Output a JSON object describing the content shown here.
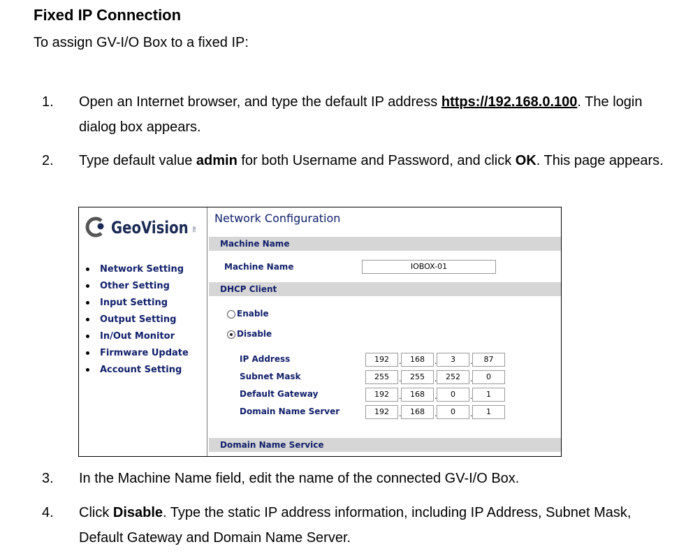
{
  "heading": "Fixed IP Connection",
  "intro": "To assign GV-I/O Box to a fixed IP:",
  "steps": [
    {
      "num": "1.",
      "pre": "Open an Internet browser, and type the default IP address ",
      "link": "https://192.168.0.100",
      "post": ". The login dialog box appears."
    },
    {
      "num": "2.",
      "pre": "Type default value ",
      "bold1": "admin",
      "mid": " for both Username and Password, and click ",
      "bold2": "OK",
      "post": ". This page appears."
    },
    {
      "num": "3.",
      "text": "In the Machine Name field, edit the name of the connected GV-I/O Box."
    },
    {
      "num": "4.",
      "pre": "Click ",
      "bold1": "Disable",
      "post": ". Type the static IP address information, including IP Address, Subnet Mask, Default Gateway and Domain Name Server."
    }
  ],
  "screenshot": {
    "logo": "GeoVision",
    "logo_suffix": "inc",
    "menu": [
      "Network Setting",
      "Other Setting",
      "Input Setting",
      "Output Setting",
      "In/Out Monitor",
      "Firmware Update",
      "Account Setting"
    ],
    "title": "Network Configuration",
    "section_machine": "Machine Name",
    "machine_label": "Machine Name",
    "machine_value": "IOBOX-01",
    "section_dhcp": "DHCP Client",
    "enable": "Enable",
    "disable": "Disable",
    "selected": "Disable",
    "fields": [
      {
        "label": "IP Address",
        "octets": [
          "192",
          "168",
          "3",
          "87"
        ]
      },
      {
        "label": "Subnet Mask",
        "octets": [
          "255",
          "255",
          "252",
          "0"
        ]
      },
      {
        "label": "Default Gateway",
        "octets": [
          "192",
          "168",
          "0",
          "1"
        ]
      },
      {
        "label": "Domain Name Server",
        "octets": [
          "192",
          "168",
          "0",
          "1"
        ]
      }
    ],
    "section_dns": "Domain Name Service",
    "colors": {
      "label": "#12206a",
      "band": "#d6d6d6",
      "logo": "#1b2a55"
    }
  }
}
